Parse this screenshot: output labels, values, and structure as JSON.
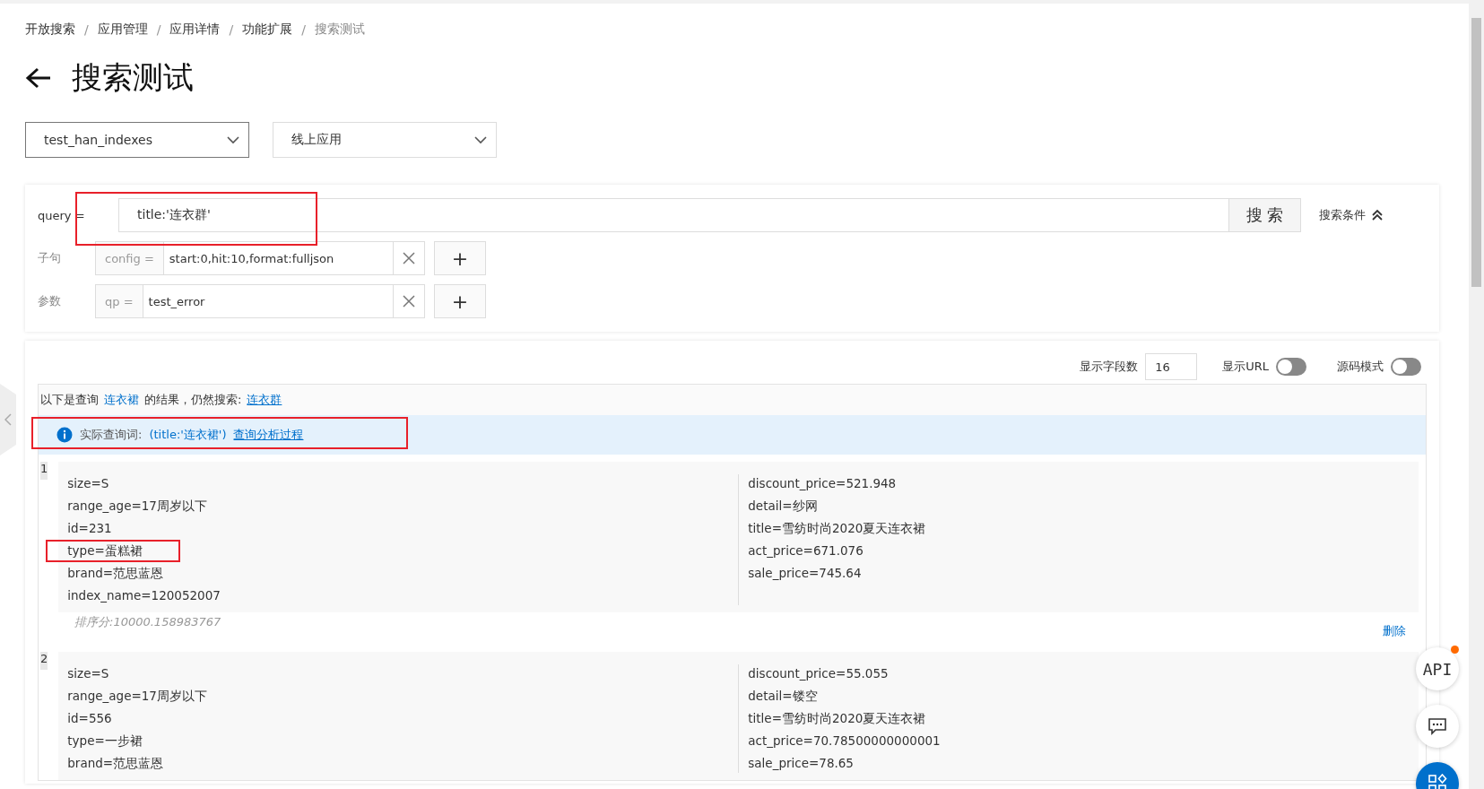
{
  "breadcrumb": [
    {
      "label": "开放搜索",
      "current": false
    },
    {
      "label": "应用管理",
      "current": false
    },
    {
      "label": "应用详情",
      "current": false
    },
    {
      "label": "功能扩展",
      "current": false
    },
    {
      "label": "搜索测试",
      "current": true
    }
  ],
  "separator": "/",
  "page_title": "搜索测试",
  "selects": [
    {
      "value": "test_han_indexes",
      "focused": true
    },
    {
      "value": "线上应用",
      "focused": false
    }
  ],
  "query": {
    "label": "query =",
    "value": "title:'连衣群'",
    "highlighted": true,
    "search_button": "搜 索",
    "conditions_toggle": "搜索条件",
    "expanded": true
  },
  "clauses": [
    {
      "label": "子句",
      "prefix": "config =",
      "value": "start:0,hit:10,format:fulljson",
      "add": "+"
    },
    {
      "label": "参数",
      "prefix": "qp =",
      "value": "test_error",
      "add": "+"
    }
  ],
  "options": {
    "field_count_label": "显示字段数",
    "field_count": "16",
    "toggles": [
      {
        "label": "显示URL",
        "on": false
      },
      {
        "label": "源码模式",
        "on": false
      }
    ]
  },
  "correction": {
    "prefix": "以下是查询",
    "corrected": "连衣裙",
    "middle": "的结果，仍然搜索:",
    "original": "连衣群"
  },
  "notice": {
    "label": "实际查询词:",
    "query": "(title:'连衣裙')",
    "link": "查询分析过程",
    "highlighted": true
  },
  "results": [
    {
      "index": "1",
      "left": [
        {
          "text": "size=S",
          "highlighted": false
        },
        {
          "text": "range_age=17周岁以下",
          "highlighted": false
        },
        {
          "text": "id=231",
          "highlighted": false
        },
        {
          "text": "type=蛋糕裙",
          "highlighted": true
        },
        {
          "text": "brand=范思蓝恩",
          "highlighted": false
        },
        {
          "text": "index_name=120052007",
          "highlighted": false
        }
      ],
      "right": [
        {
          "text": "discount_price=521.948",
          "highlighted": false
        },
        {
          "text": "detail=纱网",
          "highlighted": false
        },
        {
          "text": "title=雪纺时尚2020夏天连衣裙",
          "highlighted": false
        },
        {
          "text": "act_price=671.076",
          "highlighted": false
        },
        {
          "text": "sale_price=745.64",
          "highlighted": false
        }
      ],
      "score": "排序分:10000.158983767",
      "delete": "删除"
    },
    {
      "index": "2",
      "left": [
        {
          "text": "size=S",
          "highlighted": false
        },
        {
          "text": "range_age=17周岁以下",
          "highlighted": false
        },
        {
          "text": "id=556",
          "highlighted": false
        },
        {
          "text": "type=一步裙",
          "highlighted": false
        },
        {
          "text": "brand=范思蓝恩",
          "highlighted": false
        }
      ],
      "right": [
        {
          "text": "discount_price=55.055",
          "highlighted": false
        },
        {
          "text": "detail=镂空",
          "highlighted": false
        },
        {
          "text": "title=雪纺时尚2020夏天连衣裙",
          "highlighted": false
        },
        {
          "text": "act_price=70.78500000000001",
          "highlighted": false
        },
        {
          "text": "sale_price=78.65",
          "highlighted": false
        }
      ]
    }
  ],
  "float_buttons": [
    {
      "kind": "api",
      "label": "API",
      "badge": true
    },
    {
      "kind": "chat",
      "badge": false
    },
    {
      "kind": "apps",
      "badge": false
    }
  ]
}
